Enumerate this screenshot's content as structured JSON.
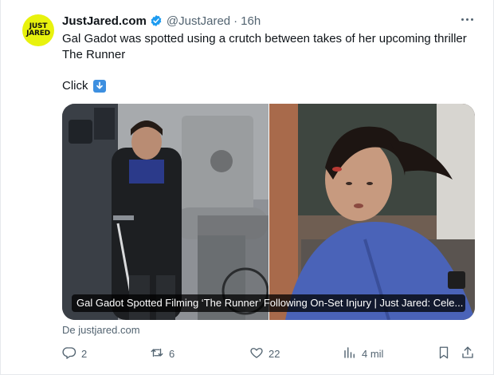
{
  "account": {
    "avatar_text_top": "JUST",
    "avatar_text_bottom": "JARED",
    "display_name": "JustJared.com",
    "handle": "@JustJared",
    "separator": "·",
    "time": "16h"
  },
  "tweet": {
    "text_line1": "Gal Gadot was spotted using a crutch between takes of her upcoming thriller",
    "text_line2": "The Runner",
    "click_text": "Click"
  },
  "card": {
    "caption": "Gal Gadot Spotted Filming ‘The Runner’ Following On-Set Injury | Just Jared: Cele...",
    "source": "De justjared.com"
  },
  "actions": {
    "replies": "2",
    "retweets": "6",
    "likes": "22",
    "views": "4 mil"
  },
  "colors": {
    "avatar_bg": "#e8f20d",
    "verified_blue": "#1d9bf0",
    "muted_text": "#536471",
    "arrow_emoji_bg": "#3d8fe0"
  },
  "icons": [
    "verified-badge-icon",
    "more-icon",
    "arrow-down-emoji-icon",
    "reply-icon",
    "retweet-icon",
    "like-icon",
    "views-icon",
    "bookmark-icon",
    "share-icon"
  ]
}
